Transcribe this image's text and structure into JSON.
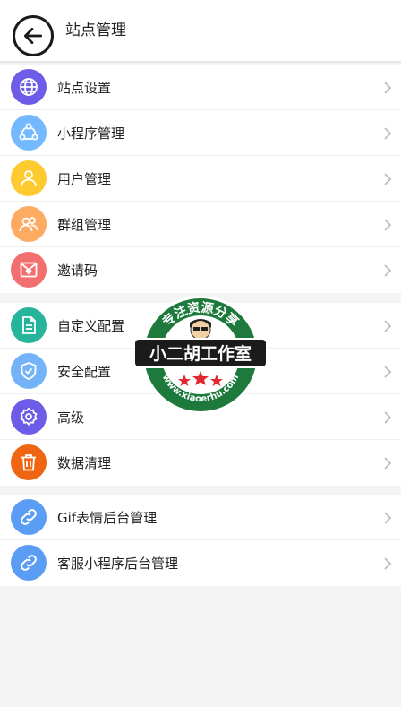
{
  "header": {
    "title": "站点管理",
    "back_icon": "arrow-left-icon"
  },
  "groups": [
    {
      "items": [
        {
          "label": "站点设置",
          "icon": "globe-icon",
          "color": "#6c5ce7"
        },
        {
          "label": "小程序管理",
          "icon": "share-nodes-icon",
          "color": "#74b9ff"
        },
        {
          "label": "用户管理",
          "icon": "user-icon",
          "color": "#fdcb2f"
        },
        {
          "label": "群组管理",
          "icon": "users-icon",
          "color": "#fdab63"
        },
        {
          "label": "邀请码",
          "icon": "envelope-heart-icon",
          "color": "#f36f6f"
        }
      ]
    },
    {
      "items": [
        {
          "label": "自定义配置",
          "icon": "document-icon",
          "color": "#26b59a"
        },
        {
          "label": "安全配置",
          "icon": "shield-check-icon",
          "color": "#74b3f7"
        },
        {
          "label": "高级",
          "icon": "gear-icon",
          "color": "#6c5ce7"
        },
        {
          "label": "数据清理",
          "icon": "trash-icon",
          "color": "#f06512"
        }
      ]
    },
    {
      "items": [
        {
          "label": "Gif表情后台管理",
          "icon": "link-icon",
          "color": "#5b9df5"
        },
        {
          "label": "客服小程序后台管理",
          "icon": "link-icon",
          "color": "#5b9df5"
        }
      ]
    }
  ],
  "watermark": {
    "top_text": "专注资源分享",
    "main_text": "小二胡工作室",
    "url_text": "www.xiaoerhu.com"
  }
}
